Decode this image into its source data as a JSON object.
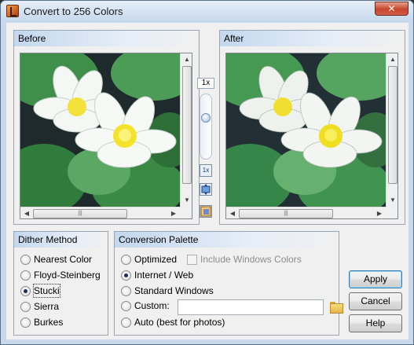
{
  "window": {
    "title": "Convert to 256 Colors",
    "close_label": "✕"
  },
  "before_panel": {
    "title": "Before"
  },
  "after_panel": {
    "title": "After"
  },
  "zoom": {
    "level": "1x",
    "reset_label": "1x"
  },
  "scroll": {
    "thumb_grip": "|||",
    "up": "▲",
    "down": "▼",
    "left": "◀",
    "right": "▶"
  },
  "dither": {
    "title": "Dither Method",
    "options": [
      {
        "label": "Nearest Color",
        "selected": false
      },
      {
        "label": "Floyd-Steinberg",
        "selected": false
      },
      {
        "label": "Stucki",
        "selected": true
      },
      {
        "label": "Sierra",
        "selected": false
      },
      {
        "label": "Burkes",
        "selected": false
      }
    ]
  },
  "palette": {
    "title": "Conversion Palette",
    "optimized": "Optimized",
    "include_windows": "Include Windows Colors",
    "internet_web": "Internet / Web",
    "standard_windows": "Standard Windows",
    "custom": "Custom:",
    "custom_value": "",
    "auto": "Auto (best for photos)",
    "selected": "Internet / Web"
  },
  "buttons": {
    "apply": "Apply",
    "cancel": "Cancel",
    "help": "Help"
  }
}
